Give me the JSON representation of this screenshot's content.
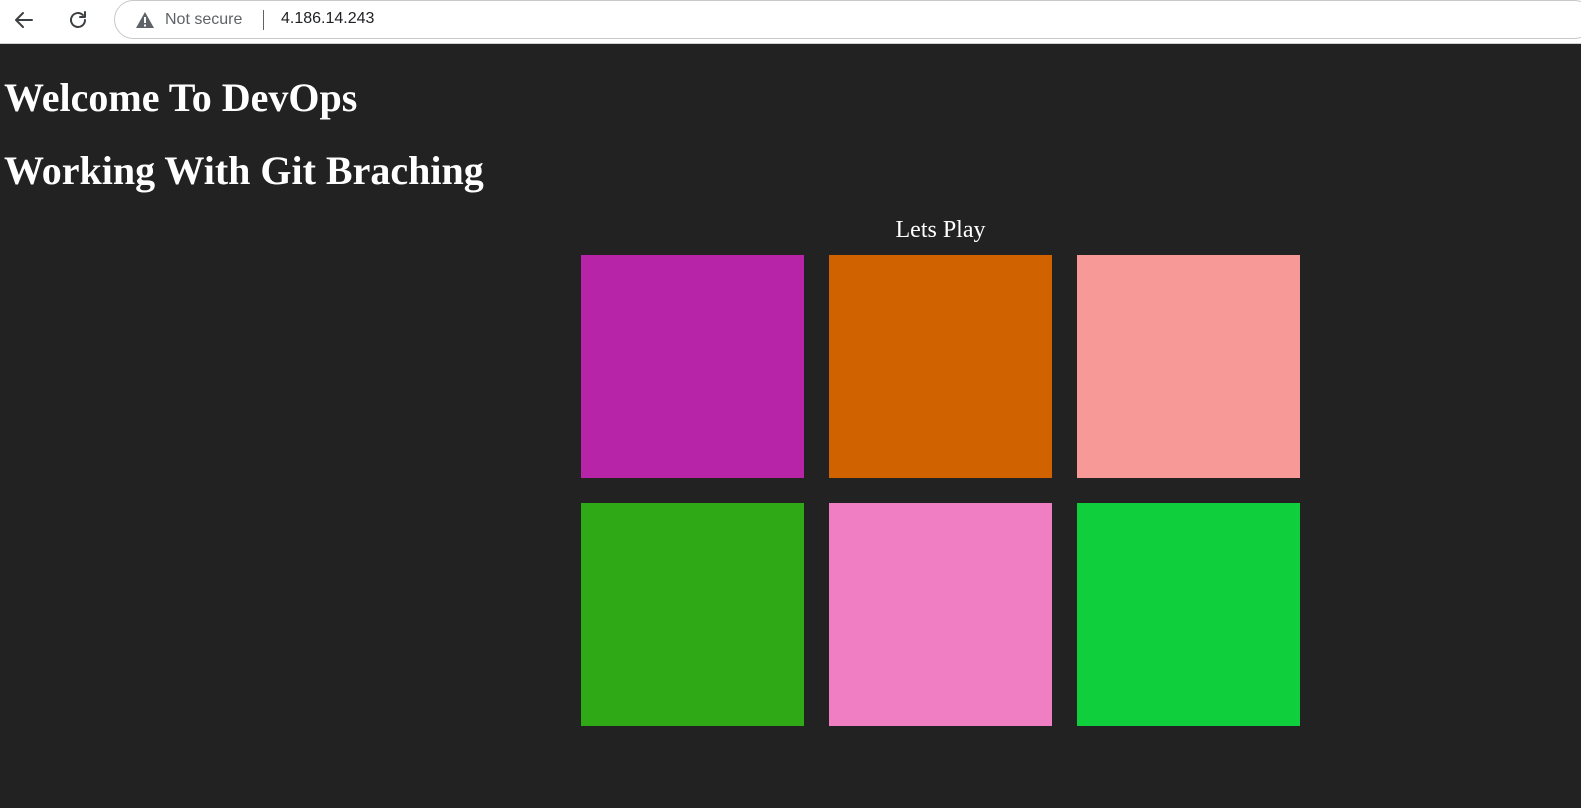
{
  "browser": {
    "security_label": "Not secure",
    "url": "4.186.14.243"
  },
  "page": {
    "heading1": "Welcome To DevOps",
    "heading2": "Working With Git Braching",
    "caption": "Lets Play"
  },
  "tiles": [
    {
      "color": "#b824a8"
    },
    {
      "color": "#d06200"
    },
    {
      "color": "#f79a97"
    },
    {
      "color": "#2fa916"
    },
    {
      "color": "#ef7fc2"
    },
    {
      "color": "#10cf3c"
    }
  ],
  "colors": {
    "page_background": "#222222",
    "text": "#ffffff"
  }
}
